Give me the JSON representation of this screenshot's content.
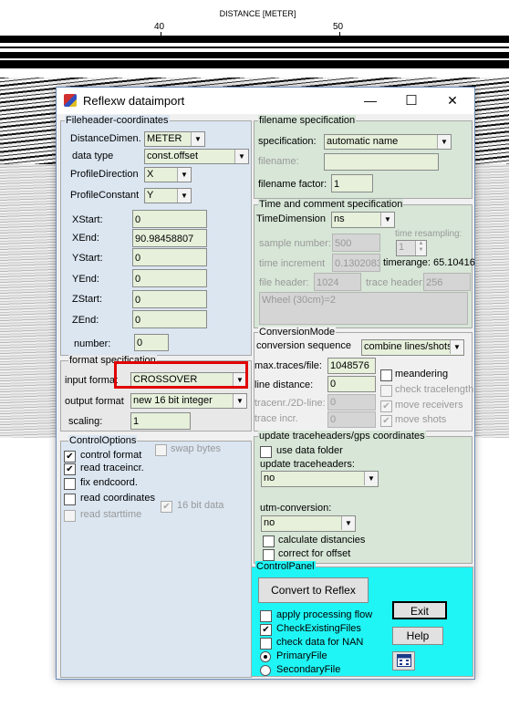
{
  "plot": {
    "axis_title": "DISTANCE [METER]",
    "ticks": [
      "40",
      "50"
    ]
  },
  "window": {
    "title": "Reflexw dataimport",
    "minimize": "—",
    "maximize": "☐",
    "close": "✕"
  },
  "fileheader": {
    "legend": "Fileheader-coordinates",
    "distance_dim_label": "DistanceDimen.",
    "distance_dim_value": "METER",
    "data_type_label": "data type",
    "data_type_value": "const.offset",
    "profile_direction_label": "ProfileDirection",
    "profile_direction_value": "X",
    "profile_constant_label": "ProfileConstant",
    "profile_constant_value": "Y",
    "coords": [
      {
        "label": "XStart:",
        "value": "0"
      },
      {
        "label": "XEnd:",
        "value": "90.98458807"
      },
      {
        "label": "YStart:",
        "value": "0"
      },
      {
        "label": "YEnd:",
        "value": "0"
      },
      {
        "label": "ZStart:",
        "value": "0"
      },
      {
        "label": "ZEnd:",
        "value": "0"
      }
    ],
    "number_label": "number:",
    "number_value": "0"
  },
  "format": {
    "legend": "format specification",
    "input_label": "input format",
    "input_value": "CROSSOVER",
    "output_label": "output format",
    "output_value": "new 16 bit integer",
    "scaling_label": "scaling:",
    "scaling_value": "1"
  },
  "control_options": {
    "legend": "ControlOptions",
    "control_format": "control format",
    "swap_bytes": "swap bytes",
    "read_traceincr": "read traceincr.",
    "fix_endcoord": "fix endcoord.",
    "read_coordinates": "read coordinates",
    "bit16_data": "16 bit data",
    "read_starttime": "read starttime"
  },
  "filename_spec": {
    "legend": "filename specification",
    "spec_label": "specification:",
    "spec_value": "automatic name",
    "filename_label": "filename:",
    "filename_value": "",
    "factor_label": "filename factor:",
    "factor_value": "1"
  },
  "time_spec": {
    "legend": "Time and comment specification",
    "time_dim_label": "TimeDimension",
    "time_dim_value": "ns",
    "time_resampling_label": "time resampling:",
    "time_resampling_value": "1",
    "sample_number_label": "sample number:",
    "sample_number_value": "500",
    "time_increment_label": "time increment",
    "time_increment_value": "0.1302083",
    "timerange_label": "timerange: 65.10416",
    "file_header_label": "file header:",
    "file_header_value": "1024",
    "trace_header_label": "trace header:",
    "trace_header_value": "256",
    "comment": "Wheel (30cm)=2"
  },
  "conversion_mode": {
    "legend": "ConversionMode",
    "sequence_label": "conversion sequence",
    "sequence_value": "combine lines/shots",
    "max_traces_label": "max.traces/file:",
    "max_traces_value": "1048576",
    "line_distance_label": "line distance:",
    "line_distance_value": "0",
    "tracenr_label": "tracenr./2D-line:",
    "tracenr_value": "0",
    "trace_incr_label": "trace incr.",
    "trace_incr_value": "0",
    "meandering": "meandering",
    "check_tracelength": "check tracelength",
    "move_receivers": "move receivers",
    "move_shots": "move shots"
  },
  "update_headers": {
    "legend": "update traceheaders/gps coordinates",
    "use_data_folder": "use data folder",
    "update_label": "update traceheaders:",
    "update_value": "no",
    "utm_label": "utm-conversion:",
    "utm_value": "no",
    "calculate_distancies": "calculate distancies",
    "correct_for_offset": "correct for offset"
  },
  "control_panel": {
    "legend": "ControlPanel",
    "convert_button": "Convert to Reflex",
    "apply_processing_flow": "apply processing flow",
    "check_existing_files": "CheckExistingFiles",
    "check_data_nan": "check data for NAN",
    "primary_file": "PrimaryFile",
    "secondary_file": "SecondaryFile",
    "exit_button": "Exit",
    "help_button": "Help"
  },
  "colors": {
    "fileheader_bg": "#dbe6f1",
    "right_panel_bg": "#d7e6d7",
    "control_panel_bg": "#20f5f5",
    "highlight": "#e00000"
  }
}
